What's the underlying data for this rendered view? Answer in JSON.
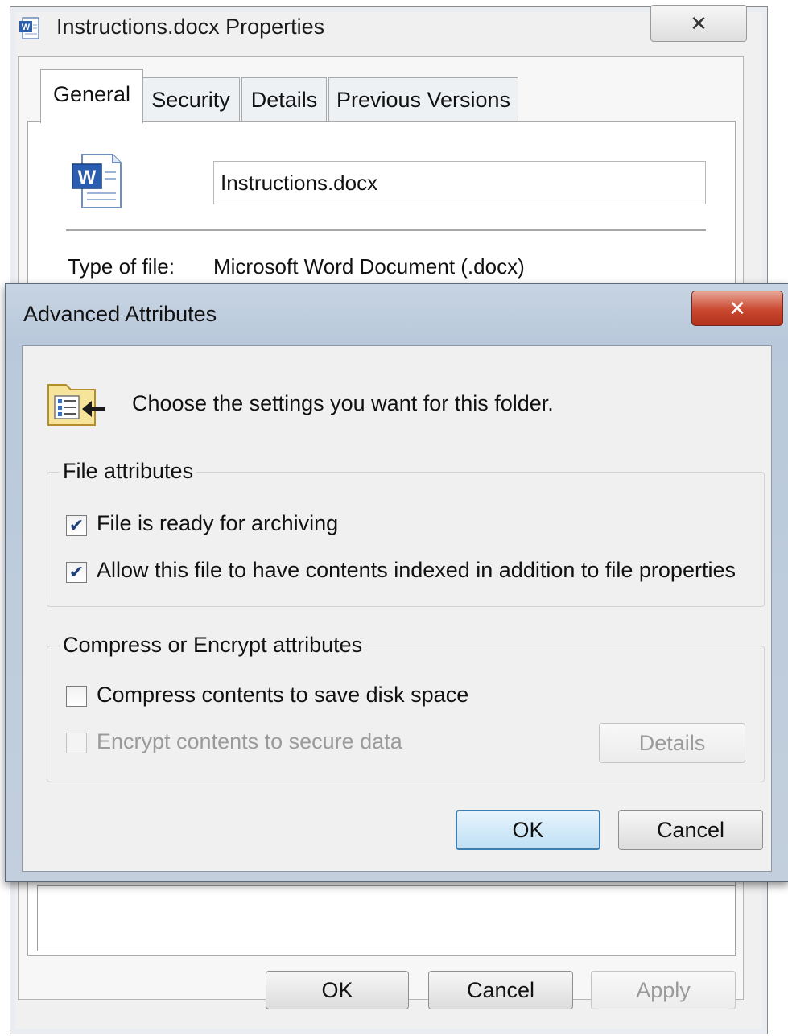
{
  "properties_window": {
    "title": "Instructions.docx Properties",
    "close_glyph": "✕",
    "tabs": [
      {
        "label": "General",
        "active": true
      },
      {
        "label": "Security",
        "active": false
      },
      {
        "label": "Details",
        "active": false
      },
      {
        "label": "Previous Versions",
        "active": false
      }
    ],
    "file_name": "Instructions.docx",
    "type_of_file_label": "Type of file:",
    "type_of_file_value": "Microsoft Word Document (.docx)",
    "buttons": {
      "ok": "OK",
      "cancel": "Cancel",
      "apply": "Apply"
    },
    "icon": "word-document-icon"
  },
  "advanced_attributes": {
    "title": "Advanced Attributes",
    "close_glyph": "✕",
    "intro": "Choose the settings you want for this folder.",
    "file_attributes": {
      "label": "File attributes",
      "options": [
        {
          "label": "File is ready for archiving",
          "checked": true,
          "enabled": true
        },
        {
          "label": "Allow this file to have contents indexed in addition to file properties",
          "checked": true,
          "enabled": true
        }
      ]
    },
    "compress_encrypt": {
      "label": "Compress or Encrypt attributes",
      "options": [
        {
          "label": "Compress contents to save disk space",
          "checked": false,
          "enabled": true
        },
        {
          "label": "Encrypt contents to secure data",
          "checked": false,
          "enabled": false
        }
      ],
      "details_button": "Details"
    },
    "buttons": {
      "ok": "OK",
      "cancel": "Cancel"
    },
    "icon": "folder-attributes-icon"
  },
  "colors": {
    "accent_blue": "#3c7fb1",
    "close_red": "#c9482f",
    "dialog_frame": "#b9c9db"
  }
}
